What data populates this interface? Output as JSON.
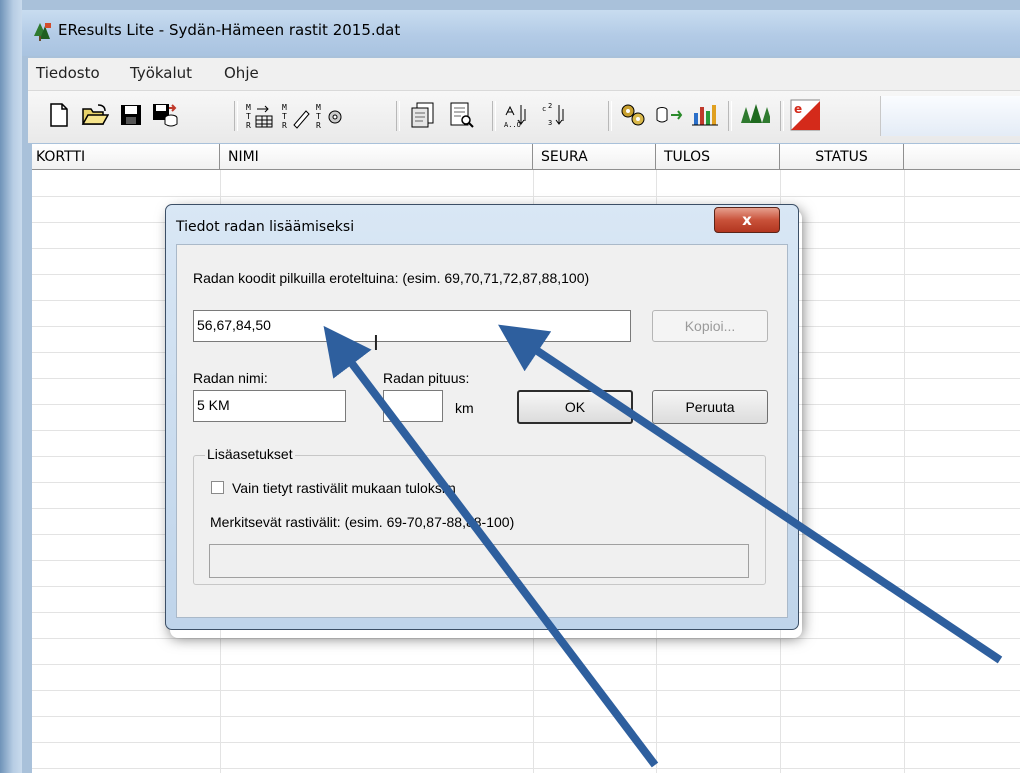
{
  "window": {
    "title": "EResults Lite - Sydän-Hämeen rastit 2015.dat"
  },
  "menu": {
    "items": [
      "Tiedosto",
      "Työkalut",
      "Ohje"
    ]
  },
  "toolbar": {
    "icons": [
      "new-file-icon",
      "open-folder-icon",
      "save-icon",
      "save-database-icon",
      "import-table-icon",
      "edit-record-icon",
      "settings-record-icon",
      "copy-document-icon",
      "print-preview-icon",
      "sort-alpha-icon",
      "sort-custom-icon",
      "network-gears-icon",
      "database-link-icon",
      "bar-chart-icon",
      "forest-trees-icon",
      "eresults-logo-icon"
    ]
  },
  "grid": {
    "columns": [
      "KORTTI",
      "NIMI",
      "SEURA",
      "TULOS",
      "STATUS"
    ]
  },
  "dialog": {
    "title": "Tiedot radan lisäämiseksi",
    "close_label": "x",
    "codes_label": "Radan koodit pilkuilla eroteltuina: (esim. 69,70,71,72,87,88,100)",
    "codes_value": "56,67,84,50",
    "copy_button": "Kopioi...",
    "name_label": "Radan nimi:",
    "name_value": "5 KM",
    "length_label": "Radan pituus:",
    "length_value": "",
    "length_unit": "km",
    "ok_button": "OK",
    "cancel_button": "Peruuta",
    "advanced_legend": "Lisäasetukset",
    "checkbox_label": "Vain tietyt rastivälit mukaan tuloksiin",
    "checkbox_checked": false,
    "legs_label": "Merkitsevät rastivälit: (esim. 69-70,87-88,88-100)",
    "legs_value": ""
  },
  "annotation": {
    "arrow_color": "#2e5f9e",
    "arrow_count": 2
  }
}
